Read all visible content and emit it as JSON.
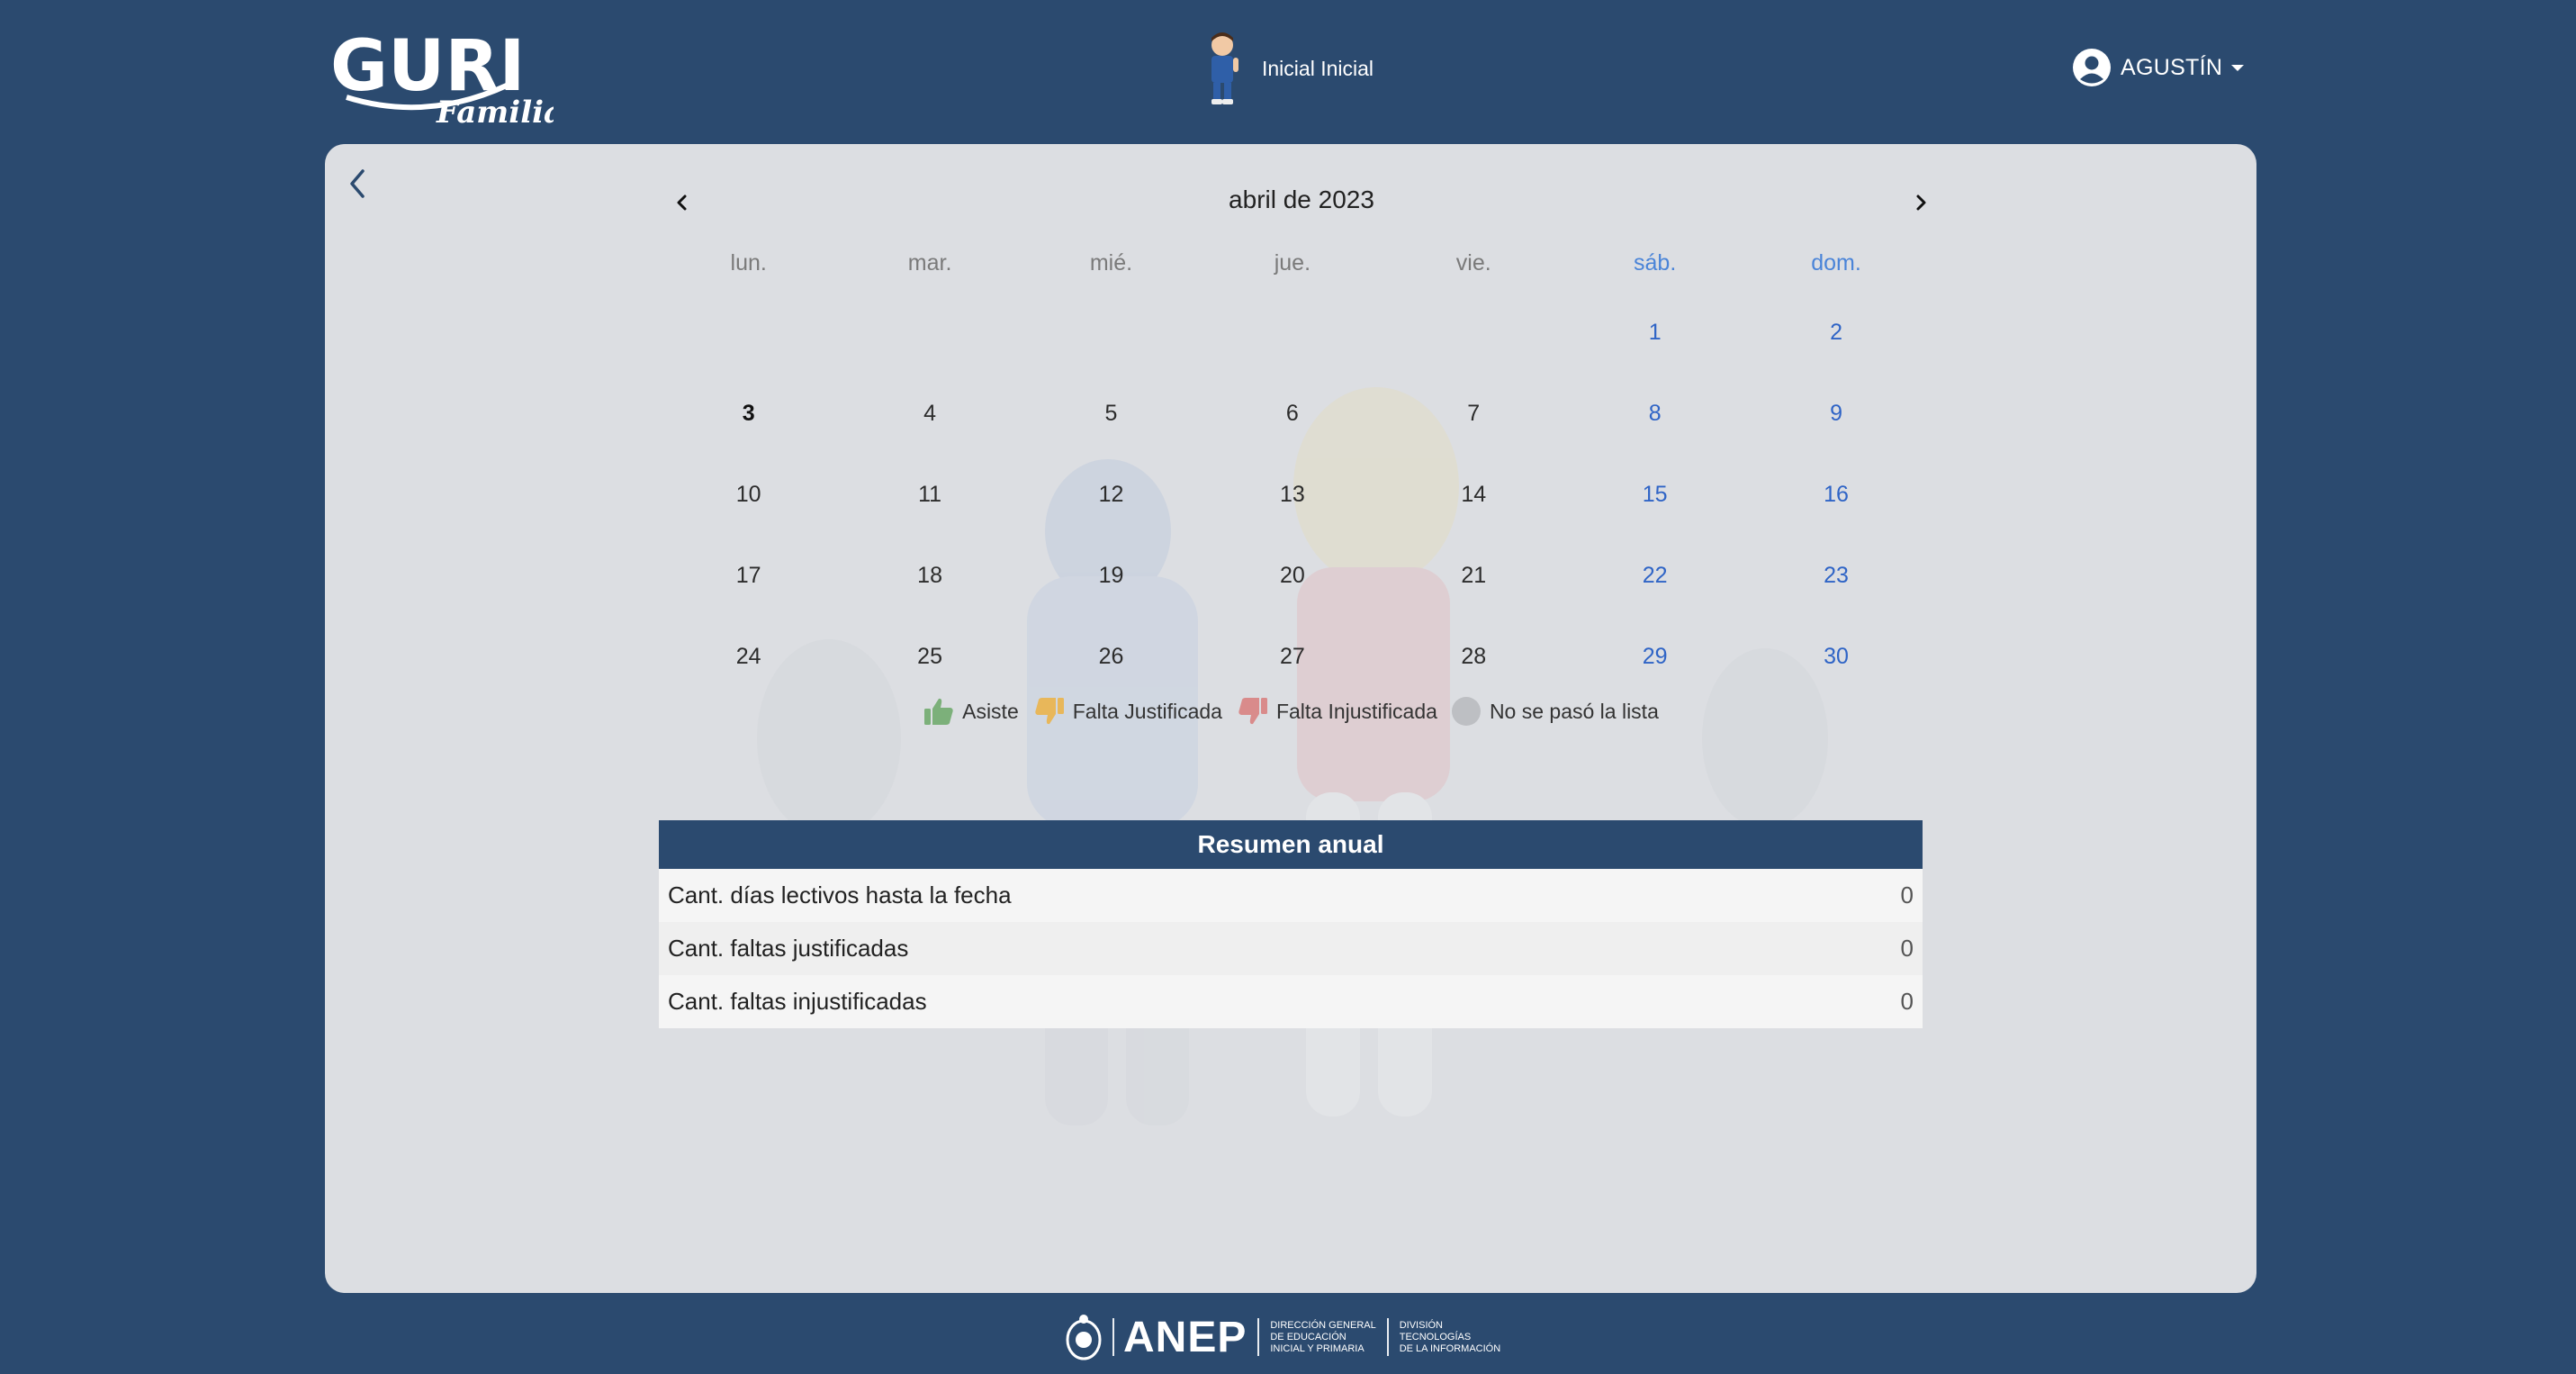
{
  "header": {
    "logo_text": "GURI",
    "logo_sub": "Familia",
    "student_name": "Inicial Inicial",
    "user_name": "AGUSTÍN"
  },
  "calendar": {
    "month_label": "abril de 2023",
    "weekdays": [
      "lun.",
      "mar.",
      "mié.",
      "jue.",
      "vie.",
      "sáb.",
      "dom."
    ],
    "weeks": [
      [
        "",
        "",
        "",
        "",
        "",
        "1",
        "2"
      ],
      [
        "3",
        "4",
        "5",
        "6",
        "7",
        "8",
        "9"
      ],
      [
        "10",
        "11",
        "12",
        "13",
        "14",
        "15",
        "16"
      ],
      [
        "17",
        "18",
        "19",
        "20",
        "21",
        "22",
        "23"
      ],
      [
        "24",
        "25",
        "26",
        "27",
        "28",
        "29",
        "30"
      ]
    ],
    "today": "3"
  },
  "legend": {
    "asiste": "Asiste",
    "falta_justificada": "Falta Justificada",
    "falta_injustificada": "Falta Injustificada",
    "no_lista": "No se pasó la lista"
  },
  "summary": {
    "title": "Resumen anual",
    "rows": [
      {
        "label": "Cant. días lectivos hasta la fecha",
        "value": "0"
      },
      {
        "label": "Cant. faltas justificadas",
        "value": "0"
      },
      {
        "label": "Cant. faltas injustificadas",
        "value": "0"
      }
    ]
  },
  "footer": {
    "brand": "ANEP",
    "line1": "DIRECCIÓN GENERAL",
    "line2": "DE EDUCACIÓN",
    "line3": "INICIAL Y PRIMARIA",
    "line4": "DIVISIÓN",
    "line5": "TECNOLOGÍAS",
    "line6": "DE LA INFORMACIÓN"
  },
  "colors": {
    "background": "#2b4a6f",
    "card": "#dcdee2",
    "weekend": "#2f64c6",
    "asiste": "#7cb07a",
    "justificada": "#e8b75a",
    "injustificada": "#d98b8b"
  }
}
